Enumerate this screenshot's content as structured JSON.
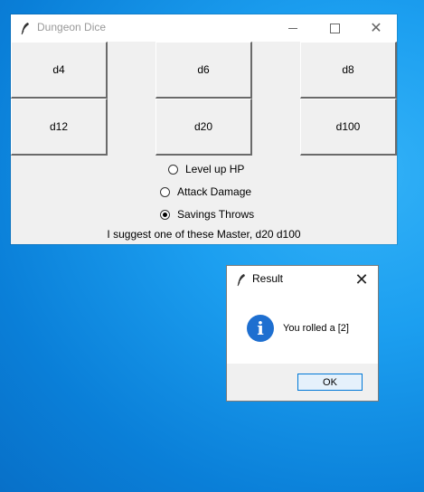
{
  "main_window": {
    "title": "Dungeon Dice",
    "controls": {
      "minimize": "—",
      "maximize": "☐",
      "close": "✕"
    },
    "dice_buttons": [
      "d4",
      "d6",
      "d8",
      "d12",
      "d20",
      "d100"
    ],
    "radio_options": [
      {
        "label": "Level up HP",
        "checked": false
      },
      {
        "label": "Attack Damage",
        "checked": false
      },
      {
        "label": "Savings Throws",
        "checked": true
      }
    ],
    "suggestion": "I suggest one of these Master, d20 d100"
  },
  "result_dialog": {
    "title": "Result",
    "message": "You rolled a [2]",
    "ok_label": "OK",
    "icon": "info-icon"
  },
  "colors": {
    "desktop": "#1c9ff0",
    "info_blue": "#1e6fd0",
    "ok_border": "#0078d7"
  }
}
